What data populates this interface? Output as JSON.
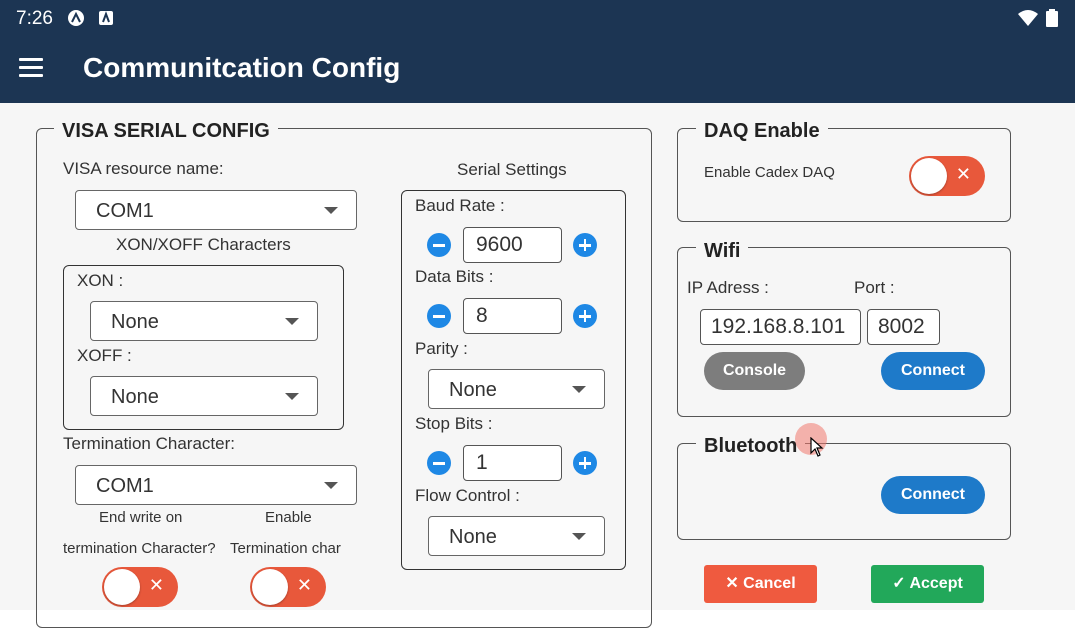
{
  "status": {
    "time": "7:26"
  },
  "appbar": {
    "title": "Communitcation Config"
  },
  "visa": {
    "legend": "VISA SERIAL CONFIG",
    "resource_label": "VISA resource name:",
    "resource_value": "COM1",
    "xonxoff_label": "XON/XOFF Characters",
    "xon_label": "XON :",
    "xon_value": "None",
    "xoff_label": "XOFF :",
    "xoff_value": "None",
    "term_label": "Termination Character:",
    "term_value": "COM1",
    "end_write_1": "End write on",
    "end_write_2": "termination Character?",
    "enable_1": "Enable",
    "enable_2": "Termination char",
    "toggle_x": "✕"
  },
  "serial": {
    "title": "Serial Settings",
    "baud_label": "Baud Rate :",
    "baud_value": "9600",
    "data_label": "Data Bits :",
    "data_value": "8",
    "parity_label": "Parity :",
    "parity_value": "None",
    "stop_label": "Stop Bits :",
    "stop_value": "1",
    "flow_label": "Flow Control :",
    "flow_value": "None"
  },
  "daq": {
    "legend": "DAQ Enable",
    "label": "Enable Cadex DAQ",
    "toggle_x": "✕"
  },
  "wifi": {
    "legend": "Wifi",
    "ip_label": "IP Adress :",
    "port_label": "Port :",
    "ip_value": "192.168.8.101",
    "port_value": "8002",
    "console": "Console",
    "connect": "Connect"
  },
  "bluetooth": {
    "legend": "Bluetooth",
    "connect": "Connect"
  },
  "actions": {
    "cancel": "✕ Cancel",
    "accept": "✓ Accept"
  },
  "colors": {
    "appbar": "#1c3553",
    "toggle_off": "#e8583b",
    "primary": "#1e7ac9",
    "cancel": "#ef5a3f",
    "accept": "#22a85a"
  }
}
